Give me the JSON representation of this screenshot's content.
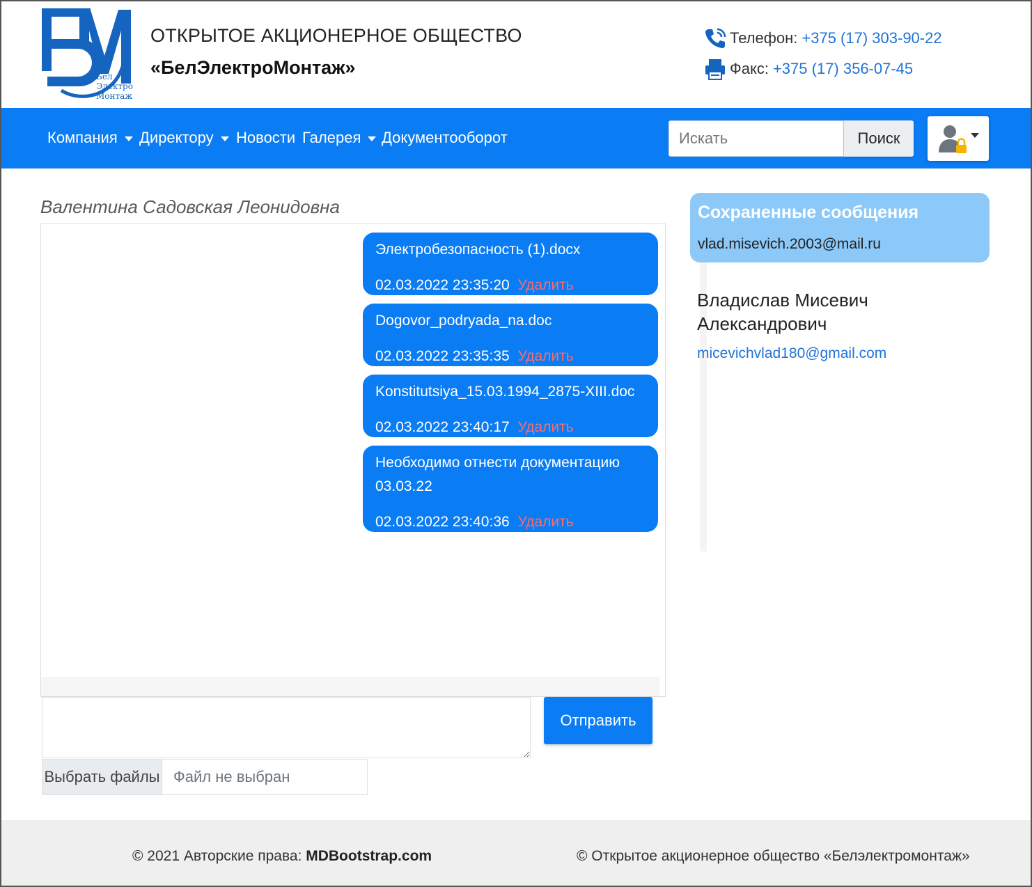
{
  "header": {
    "logo_text": [
      "Бел",
      "Электро",
      "Монтаж"
    ],
    "company_line1": "ОТКРЫТОЕ АКЦИОНЕРНОЕ ОБЩЕСТВО",
    "company_line2": "«БелЭлектроМонтаж»",
    "phone_label": "Телефон:",
    "phone_value": "+375 (17) 303-90-22",
    "fax_label": "Факс:",
    "fax_value": "+375 (17) 356-07-45",
    "icons": {
      "phone": "phone-icon",
      "fax": "printer-icon"
    }
  },
  "navbar": {
    "items": [
      {
        "label": "Компания",
        "dropdown": true
      },
      {
        "label": "Директору",
        "dropdown": true
      },
      {
        "label": "Новости",
        "dropdown": false
      },
      {
        "label": "Галерея",
        "dropdown": true
      },
      {
        "label": "Документооборот",
        "dropdown": false
      }
    ],
    "search_placeholder": "Искать",
    "search_button": "Поиск",
    "user_icon": "user-lock-icon"
  },
  "chat": {
    "title": "Валентина Садовская Леонидовна",
    "delete_label": "Удалить",
    "messages": [
      {
        "text": "Электробезопасность (1).docx",
        "time": "02.03.2022 23:35:20"
      },
      {
        "text": "Dogovor_podryada_na.doc",
        "time": "02.03.2022 23:35:35"
      },
      {
        "text": "Konstitutsiya_15.03.1994_2875-XIII.doc",
        "time": "02.03.2022 23:40:17"
      },
      {
        "text": "Необходимо отнести документацию 03.03.22",
        "time": "02.03.2022 23:40:36"
      }
    ],
    "input_value": "",
    "send_button": "Отправить",
    "file_button": "Выбрать файлы",
    "file_status": "Файл не выбран"
  },
  "sidebar": {
    "saved_title": "Сохраненные сообщения",
    "saved_email": "vlad.misevich.2003@mail.ru",
    "contact_name": "Владислав Мисевич Александрович",
    "contact_email": "micevichvlad180@gmail.com"
  },
  "footer": {
    "left_prefix": "© 2021 Авторские права: ",
    "left_link": "MDBootstrap.com",
    "right": "© Открытое акционерное общество «Белэлектромонтаж»"
  },
  "colors": {
    "primary": "#0a7cf4",
    "saved_card": "#8cc8f8",
    "link": "#1f73d8",
    "delete": "#ff6b6b"
  }
}
